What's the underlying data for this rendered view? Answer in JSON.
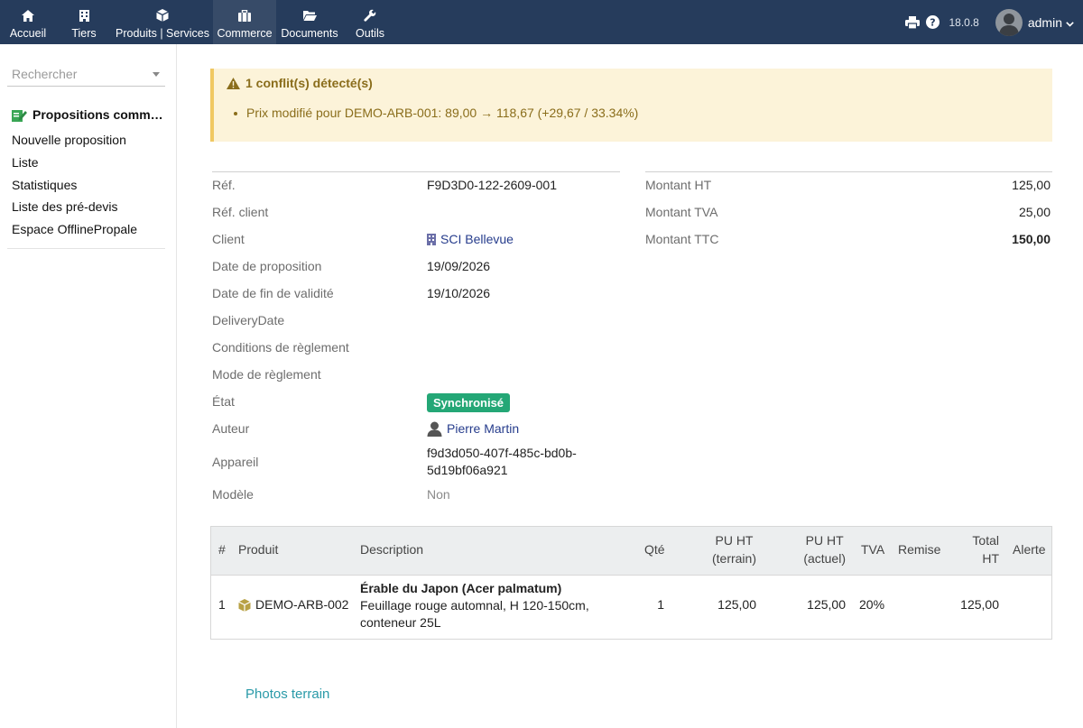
{
  "topbar": {
    "nav": [
      {
        "label": "Accueil",
        "icon": "home-icon"
      },
      {
        "label": "Tiers",
        "icon": "building-icon"
      },
      {
        "label": "Produits | Services",
        "icon": "cube-icon"
      },
      {
        "label": "Commerce",
        "icon": "briefcase-icon"
      },
      {
        "label": "Documents",
        "icon": "folder-icon"
      },
      {
        "label": "Outils",
        "icon": "wrench-icon"
      }
    ],
    "version": "18.0.8",
    "user": "admin"
  },
  "sidebar": {
    "search_placeholder": "Rechercher",
    "title": "Propositions comm…",
    "items": [
      "Nouvelle proposition",
      "Liste",
      "Statistiques",
      "Liste des pré-devis",
      "Espace OfflinePropale"
    ]
  },
  "alert": {
    "title": "1 conflit(s) détecté(s)",
    "items": [
      "Prix modifié pour DEMO-ARB-001: 89,00 → 118,67 (+29,67 / 33.34%)"
    ]
  },
  "fields": {
    "ref_label": "Réf.",
    "ref_value": "F9D3D0-122-2609-001",
    "ref_client_label": "Réf. client",
    "client_label": "Client",
    "client_value": "SCI Bellevue",
    "date_label": "Date de proposition",
    "date_value": "19/09/2026",
    "end_label": "Date de fin de validité",
    "end_value": "19/10/2026",
    "delivery_label": "DeliveryDate",
    "conditions_label": "Conditions de règlement",
    "mode_label": "Mode de règlement",
    "etat_label": "État",
    "etat_value": "Synchronisé",
    "auteur_label": "Auteur",
    "auteur_value": "Pierre Martin",
    "appareil_label": "Appareil",
    "appareil_line1": "f9d3d050-407f-485c-bd0b-",
    "appareil_line2": "5d19bf06a921",
    "modele_label": "Modèle",
    "modele_value": "Non"
  },
  "amounts": {
    "ht_label": "Montant HT",
    "ht_value": "125,00",
    "tva_label": "Montant TVA",
    "tva_value": "25,00",
    "ttc_label": "Montant TTC",
    "ttc_value": "150,00"
  },
  "table": {
    "headers": {
      "num": "#",
      "produit": "Produit",
      "description": "Description",
      "qte": "Qté",
      "pu_terrain_1": "PU HT",
      "pu_terrain_2": "(terrain)",
      "pu_actuel_1": "PU HT",
      "pu_actuel_2": "(actuel)",
      "tva": "TVA",
      "remise": "Remise",
      "total_1": "Total",
      "total_2": "HT",
      "alerte": "Alerte"
    },
    "rows": [
      {
        "num": "1",
        "produit": "DEMO-ARB-002",
        "desc_title": "Érable du Japon (Acer palmatum)",
        "desc_line1": "Feuillage rouge automnal, H 120-150cm,",
        "desc_line2": "conteneur 25L",
        "qte": "1",
        "pu_terrain": "125,00",
        "pu_actuel": "125,00",
        "tva": "20%",
        "remise": "",
        "total": "125,00",
        "alerte": ""
      }
    ]
  },
  "photos_link": "Photos terrain"
}
